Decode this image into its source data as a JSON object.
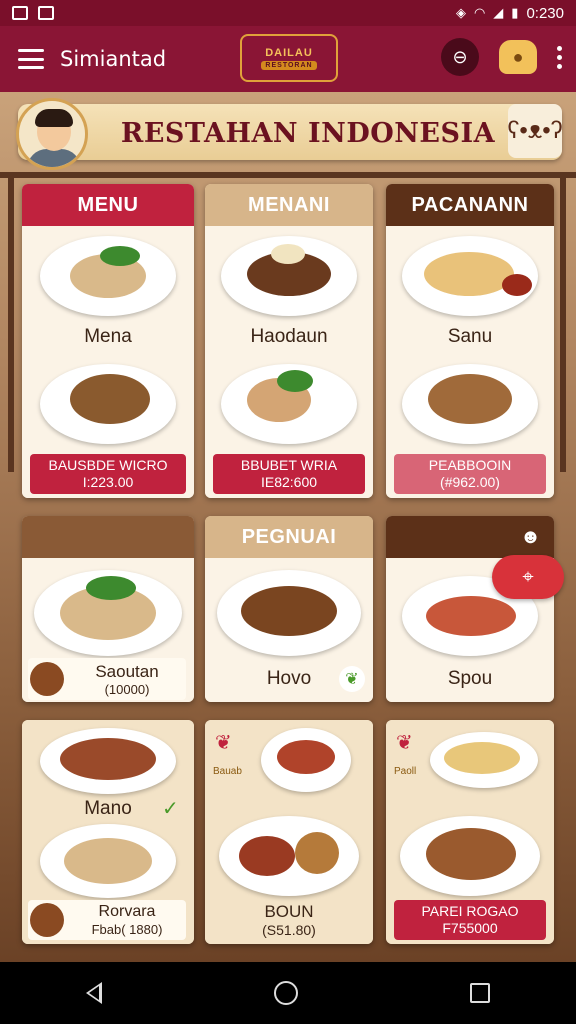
{
  "status_bar": {
    "time": "0:230"
  },
  "app_bar": {
    "title": "Simiantad",
    "logo_top": "DAILAU",
    "logo_bottom": "RESTORAN"
  },
  "banner": {
    "title": "RESTAHAN INDONESIA"
  },
  "cards": [
    {
      "header": "MENU",
      "dish1": "Mena",
      "price_title": "BAUSBDE WICRO",
      "price_value": "I:223.00"
    },
    {
      "header": "MENANI",
      "dish1": "Haodaun",
      "price_title": "BBUBET WRIA",
      "price_value": "IE82:600"
    },
    {
      "header": "PACANANN",
      "dish1": "Sanu",
      "price_title": "PEABBOOIN",
      "price_value": "(#962.00)"
    },
    {
      "header": "",
      "box_title": "Saoutan",
      "box_value": "(10000)"
    },
    {
      "header": "PEGNUAI",
      "dish1": "Hovo"
    },
    {
      "header": "",
      "dish1": "Spou"
    },
    {
      "header": "",
      "dish1": "Mano",
      "box_title": "Rorvara",
      "box_value": "Fbab( 1880)"
    },
    {
      "header": "",
      "tag": "Bauab",
      "dish1": "BOUN",
      "dish1_value": "(S51.80)"
    },
    {
      "header": "",
      "tag": "Paoll",
      "price_title": "PAREI ROGAO",
      "price_value": "F755000"
    }
  ],
  "colors": {
    "brand": "#8a1535",
    "accent": "#c0223e",
    "cream": "#f3e3c7"
  }
}
